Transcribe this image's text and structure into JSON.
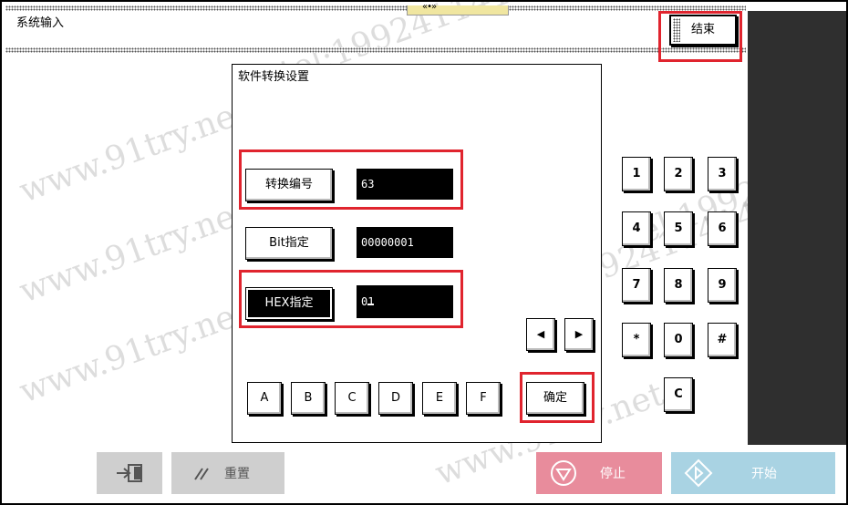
{
  "window": {
    "title": "系统输入",
    "handle_glyph": "«•»",
    "end_label": "结束"
  },
  "dialog": {
    "title": "软件转换设置",
    "rows": [
      {
        "label": "转换编号",
        "value": "63"
      },
      {
        "label": "Bit指定",
        "value": "00000001"
      },
      {
        "label": "HEX指定",
        "value": "01"
      }
    ],
    "hex_keys": [
      "A",
      "B",
      "C",
      "D",
      "E",
      "F"
    ],
    "confirm_label": "确定",
    "arrow_left": "◀",
    "arrow_right": "▶"
  },
  "keypad": {
    "keys": [
      "1",
      "2",
      "3",
      "4",
      "5",
      "6",
      "7",
      "8",
      "9",
      "*",
      "0",
      "#"
    ],
    "clear": "C"
  },
  "bottom_bar": {
    "exit_icon": "exit-icon",
    "reset_label": "重置",
    "stop_label": "停止",
    "start_label": "开始",
    "colors": {
      "stop": "#e88c9c",
      "start": "#a9d3e3",
      "gray": "#cfcfcf"
    }
  },
  "watermarks": [
    "www.91try.net",
    "tel:19924114142"
  ]
}
